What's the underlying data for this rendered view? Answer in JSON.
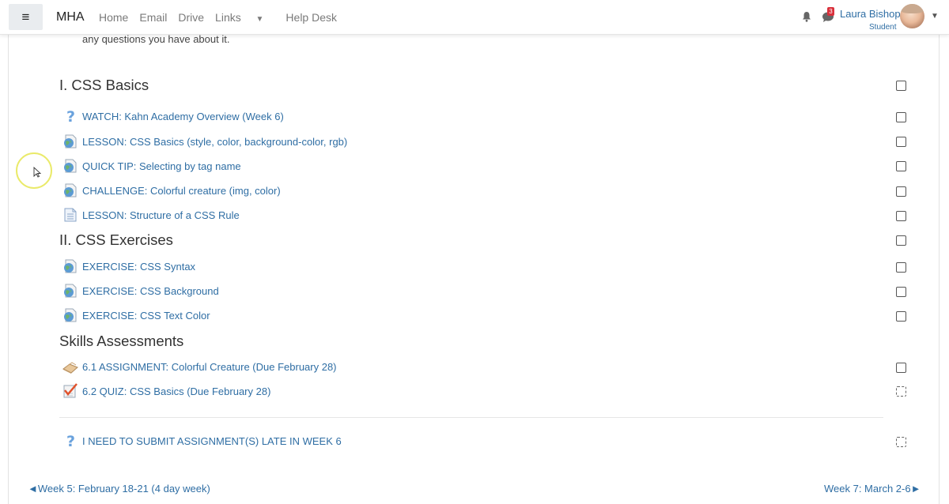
{
  "navbar": {
    "menu_icon": "≡",
    "brand": "MHA",
    "links": [
      "Home",
      "Email",
      "Drive",
      "Links",
      "Help Desk"
    ],
    "notification_count": "3",
    "user_name": "Laura Bishop",
    "user_role": "Student"
  },
  "intro_text": "any questions you have about it.",
  "sections": [
    {
      "title": "I. CSS Basics",
      "items": [
        {
          "label": "WATCH: Kahn Academy Overview (Week 6)",
          "icon": "question-icon"
        },
        {
          "label": "LESSON: CSS Basics (style, color, background-color, rgb)",
          "icon": "globe-page-icon"
        },
        {
          "label": "QUICK TIP: Selecting by tag name",
          "icon": "globe-page-icon"
        },
        {
          "label": "CHALLENGE: Colorful creature (img, color)",
          "icon": "globe-page-icon"
        },
        {
          "label": "LESSON: Structure of a CSS Rule",
          "icon": "page-icon"
        }
      ]
    },
    {
      "title": "II. CSS Exercises",
      "items": [
        {
          "label": "EXERCISE: CSS Syntax",
          "icon": "globe-page-icon"
        },
        {
          "label": "EXERCISE: CSS Background",
          "icon": "globe-page-icon"
        },
        {
          "label": "EXERCISE: CSS Text Color",
          "icon": "globe-page-icon"
        }
      ]
    },
    {
      "title": "Skills Assessments",
      "items": [
        {
          "label": "6.1 ASSIGNMENT: Colorful Creature (Due February 28)",
          "icon": "assignment-icon"
        },
        {
          "label": "6.2 QUIZ: CSS Basics (Due February 28)",
          "icon": "quiz-icon"
        }
      ]
    }
  ],
  "late_item": {
    "label": "I NEED TO SUBMIT ASSIGNMENT(S) LATE IN WEEK 6",
    "icon": "question-icon"
  },
  "pagination": {
    "prev": "◄Week 5: February 18-21 (4 day week)",
    "next": "Week 7: March 2-6►"
  },
  "colors": {
    "link": "#2f6ea4",
    "badge": "#d9303b"
  }
}
